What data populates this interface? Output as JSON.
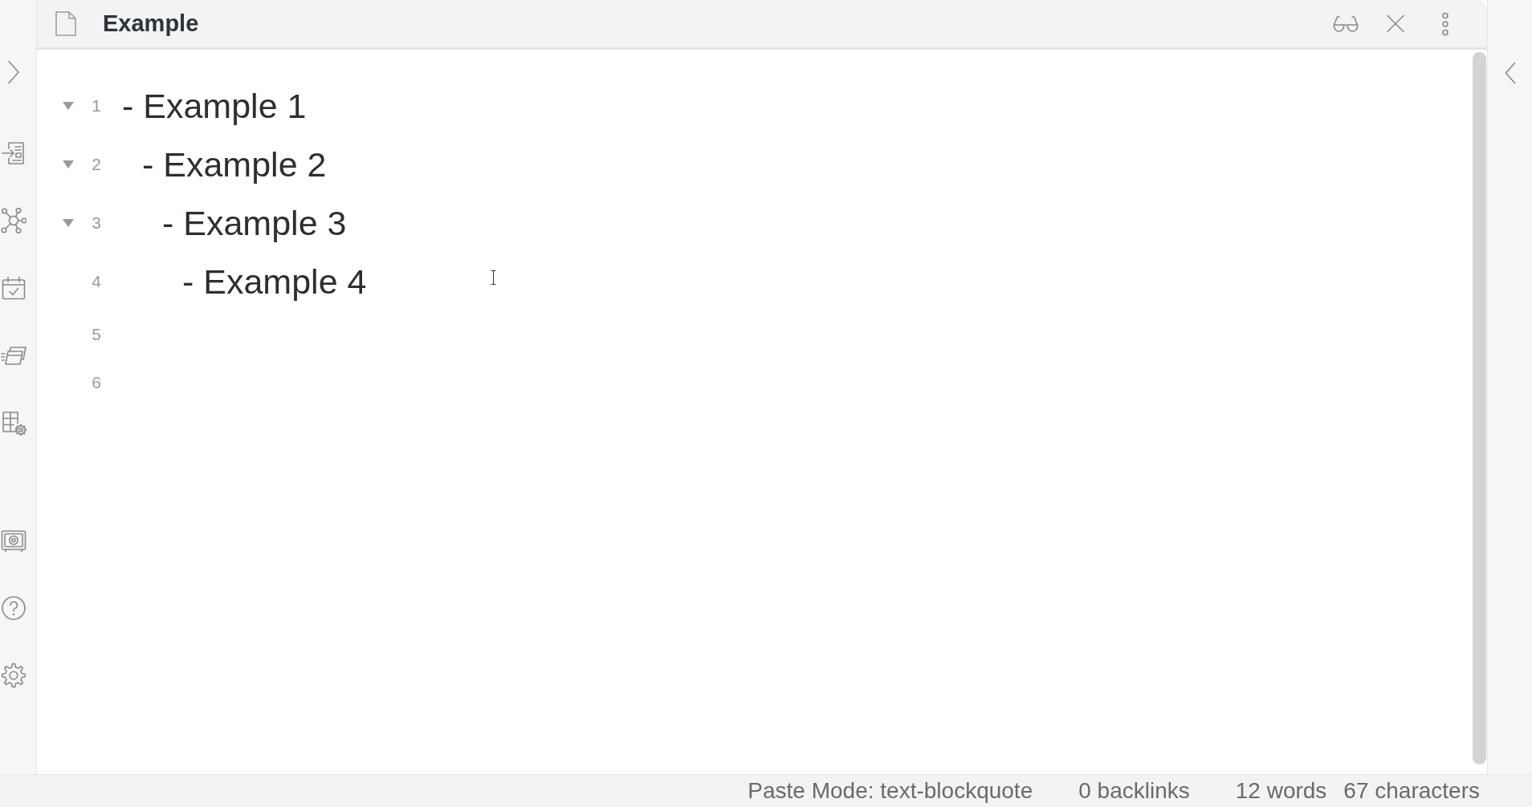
{
  "view_header": {
    "title": "Example"
  },
  "editor": {
    "lines": [
      {
        "number": "1",
        "text": "- Example 1",
        "expanded": true,
        "children": [
          {
            "number": "2",
            "text": "- Example 2",
            "expanded": true,
            "children": [
              {
                "number": "3",
                "text": "- Example 3",
                "expanded": true,
                "children": [
                  {
                    "number": "4",
                    "text": "- Example 4"
                  }
                ]
              }
            ]
          }
        ]
      },
      {
        "number": "5"
      },
      {
        "number": "6"
      }
    ]
  },
  "status_bar": {
    "items": [
      {
        "texts": [
          "Paste Mode: text-blockquote"
        ]
      },
      {
        "texts": [
          "0 backlinks"
        ]
      },
      {
        "texts": [
          "12 words",
          "67 characters"
        ]
      }
    ]
  }
}
